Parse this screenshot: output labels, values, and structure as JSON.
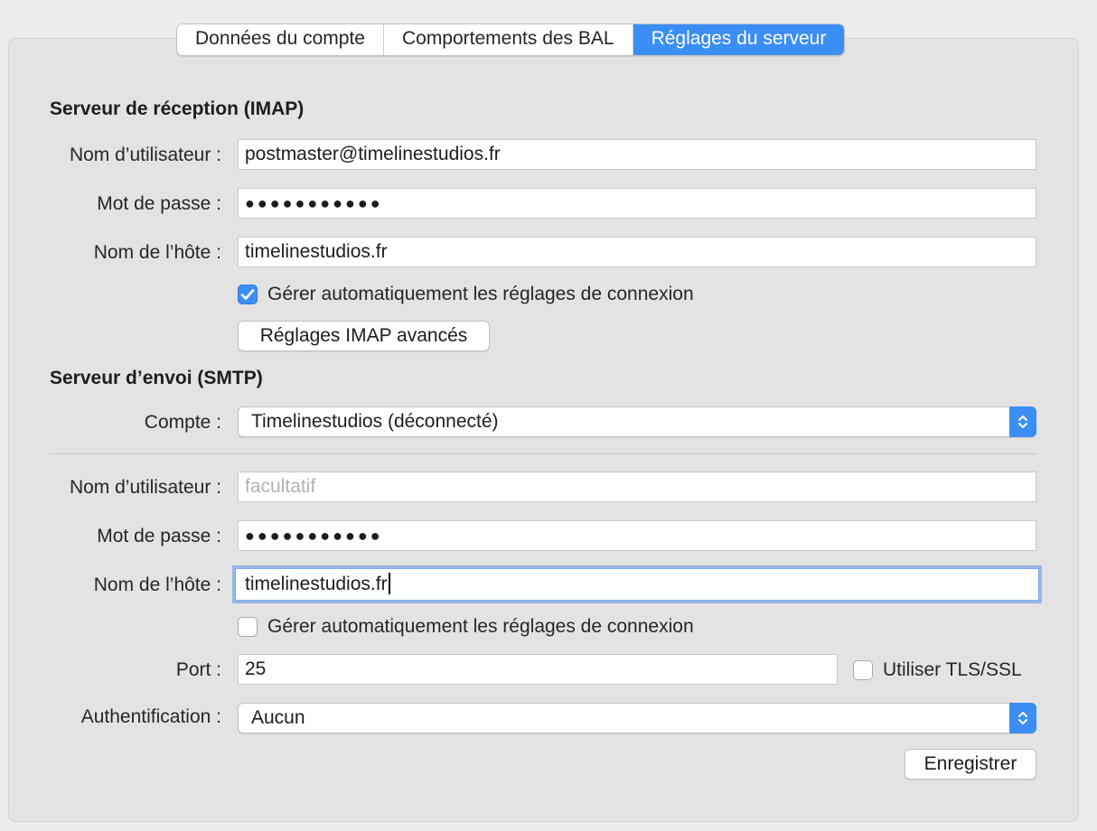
{
  "tabs": [
    {
      "label": "Données du compte",
      "active": false
    },
    {
      "label": "Comportements des BAL",
      "active": false
    },
    {
      "label": "Réglages du serveur",
      "active": true
    }
  ],
  "incoming": {
    "title": "Serveur de réception (IMAP)",
    "username_label": "Nom d’utilisateur :",
    "username_value": "postmaster@timelinestudios.fr",
    "password_label": "Mot de passe :",
    "password_value": "●●●●●●●●●●●",
    "host_label": "Nom de l’hôte :",
    "host_value": "timelinestudios.fr",
    "auto_manage_label": "Gérer automatiquement les réglages de connexion",
    "auto_manage_checked": true,
    "advanced_button": "Réglages IMAP avancés"
  },
  "outgoing": {
    "title": "Serveur d’envoi (SMTP)",
    "account_label": "Compte :",
    "account_value": "Timelinestudios (déconnecté)",
    "username_label": "Nom d’utilisateur :",
    "username_placeholder": "facultatif",
    "username_value": "",
    "password_label": "Mot de passe :",
    "password_value": "●●●●●●●●●●●",
    "host_label": "Nom de l’hôte :",
    "host_value": "timelinestudios.fr",
    "auto_manage_label": "Gérer automatiquement les réglages de connexion",
    "auto_manage_checked": false,
    "port_label": "Port :",
    "port_value": "25",
    "tls_label": "Utiliser TLS/SSL",
    "tls_checked": false,
    "auth_label": "Authentification :",
    "auth_value": "Aucun",
    "save_button": "Enregistrer"
  },
  "colors": {
    "accent": "#3b8ef5",
    "panel": "#e3e3e3",
    "background": "#ececec"
  }
}
